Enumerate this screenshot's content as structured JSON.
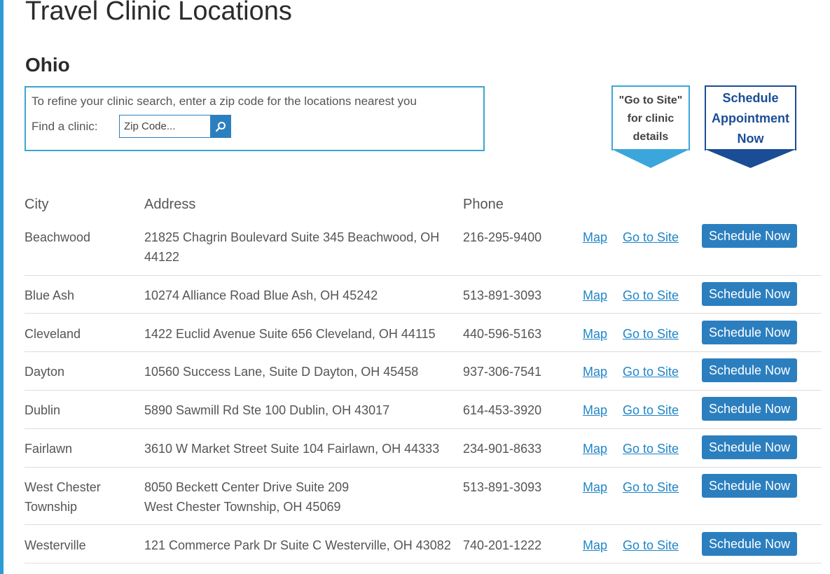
{
  "page": {
    "title": "Travel Clinic Locations",
    "state": "Ohio"
  },
  "search": {
    "hint": "To refine your clinic search, enter a zip code for the locations nearest you",
    "label": "Find a clinic:",
    "placeholder": "Zip Code...",
    "icon": "search-icon"
  },
  "badges": {
    "goto_lines": [
      "\"Go to Site\"",
      "for clinic",
      "details"
    ],
    "schedule_lines": [
      "Schedule",
      "Appointment",
      "Now"
    ],
    "goto_color": "#3aa6dc",
    "schedule_color": "#1a4d96"
  },
  "table": {
    "headers": {
      "city": "City",
      "address": "Address",
      "phone": "Phone"
    },
    "map_label": "Map",
    "site_label": "Go to Site",
    "schedule_label": "Schedule Now",
    "rows": [
      {
        "city": "Beachwood",
        "address_l1": "21825 Chagrin Boulevard Suite 345 Beachwood, OH",
        "address_l2": "44122",
        "phone": "216-295-9400"
      },
      {
        "city": "Blue Ash",
        "address_l1": "10274 Alliance Road Blue Ash, OH 45242",
        "address_l2": "",
        "phone": "513-891-3093"
      },
      {
        "city": "Cleveland",
        "address_l1": "1422 Euclid Avenue Suite 656 Cleveland, OH 44115",
        "address_l2": "",
        "phone": "440-596-5163"
      },
      {
        "city": "Dayton",
        "address_l1": "10560 Success Lane, Suite D Dayton, OH 45458",
        "address_l2": "",
        "phone": "937-306-7541"
      },
      {
        "city": "Dublin",
        "address_l1": "5890 Sawmill Rd Ste 100 Dublin, OH 43017",
        "address_l2": "",
        "phone": "614-453-3920"
      },
      {
        "city": "Fairlawn",
        "address_l1": "3610 W Market Street Suite 104 Fairlawn, OH 44333",
        "address_l2": "",
        "phone": "234-901-8633"
      },
      {
        "city": "West Chester Township",
        "address_l1": "8050 Beckett Center Drive Suite 209",
        "address_l2": "West Chester Township, OH 45069",
        "phone": "513-891-3093"
      },
      {
        "city": "Westerville",
        "address_l1": "121 Commerce Park Dr Suite C Westerville, OH 43082",
        "address_l2": "",
        "phone": "740-201-1222"
      }
    ]
  },
  "colors": {
    "accent": "#2d9bd8",
    "button": "#2c7fbf",
    "link": "#1f86c8"
  }
}
